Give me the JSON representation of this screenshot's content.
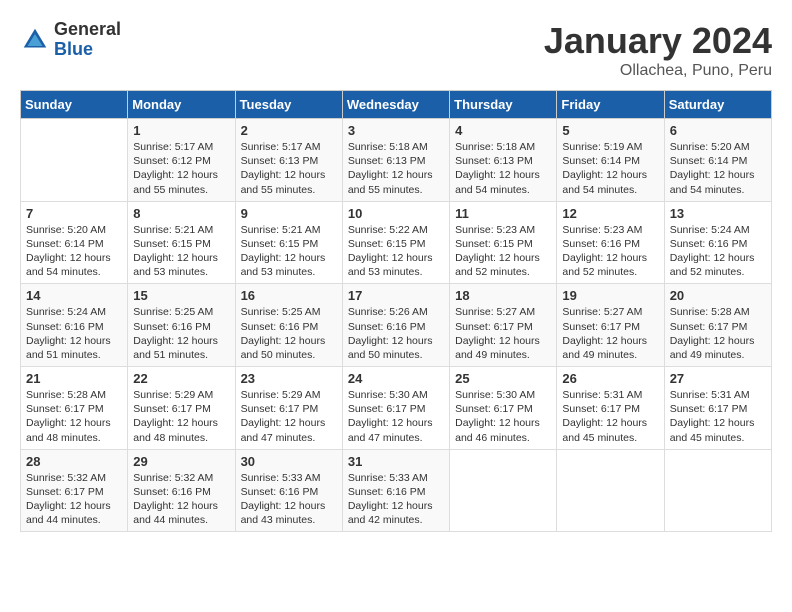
{
  "header": {
    "logo_general": "General",
    "logo_blue": "Blue",
    "month_title": "January 2024",
    "subtitle": "Ollachea, Puno, Peru"
  },
  "days_of_week": [
    "Sunday",
    "Monday",
    "Tuesday",
    "Wednesday",
    "Thursday",
    "Friday",
    "Saturday"
  ],
  "weeks": [
    [
      {
        "day": "",
        "info": ""
      },
      {
        "day": "1",
        "info": "Sunrise: 5:17 AM\nSunset: 6:12 PM\nDaylight: 12 hours\nand 55 minutes."
      },
      {
        "day": "2",
        "info": "Sunrise: 5:17 AM\nSunset: 6:13 PM\nDaylight: 12 hours\nand 55 minutes."
      },
      {
        "day": "3",
        "info": "Sunrise: 5:18 AM\nSunset: 6:13 PM\nDaylight: 12 hours\nand 55 minutes."
      },
      {
        "day": "4",
        "info": "Sunrise: 5:18 AM\nSunset: 6:13 PM\nDaylight: 12 hours\nand 54 minutes."
      },
      {
        "day": "5",
        "info": "Sunrise: 5:19 AM\nSunset: 6:14 PM\nDaylight: 12 hours\nand 54 minutes."
      },
      {
        "day": "6",
        "info": "Sunrise: 5:20 AM\nSunset: 6:14 PM\nDaylight: 12 hours\nand 54 minutes."
      }
    ],
    [
      {
        "day": "7",
        "info": "Sunrise: 5:20 AM\nSunset: 6:14 PM\nDaylight: 12 hours\nand 54 minutes."
      },
      {
        "day": "8",
        "info": "Sunrise: 5:21 AM\nSunset: 6:15 PM\nDaylight: 12 hours\nand 53 minutes."
      },
      {
        "day": "9",
        "info": "Sunrise: 5:21 AM\nSunset: 6:15 PM\nDaylight: 12 hours\nand 53 minutes."
      },
      {
        "day": "10",
        "info": "Sunrise: 5:22 AM\nSunset: 6:15 PM\nDaylight: 12 hours\nand 53 minutes."
      },
      {
        "day": "11",
        "info": "Sunrise: 5:23 AM\nSunset: 6:15 PM\nDaylight: 12 hours\nand 52 minutes."
      },
      {
        "day": "12",
        "info": "Sunrise: 5:23 AM\nSunset: 6:16 PM\nDaylight: 12 hours\nand 52 minutes."
      },
      {
        "day": "13",
        "info": "Sunrise: 5:24 AM\nSunset: 6:16 PM\nDaylight: 12 hours\nand 52 minutes."
      }
    ],
    [
      {
        "day": "14",
        "info": "Sunrise: 5:24 AM\nSunset: 6:16 PM\nDaylight: 12 hours\nand 51 minutes."
      },
      {
        "day": "15",
        "info": "Sunrise: 5:25 AM\nSunset: 6:16 PM\nDaylight: 12 hours\nand 51 minutes."
      },
      {
        "day": "16",
        "info": "Sunrise: 5:25 AM\nSunset: 6:16 PM\nDaylight: 12 hours\nand 50 minutes."
      },
      {
        "day": "17",
        "info": "Sunrise: 5:26 AM\nSunset: 6:16 PM\nDaylight: 12 hours\nand 50 minutes."
      },
      {
        "day": "18",
        "info": "Sunrise: 5:27 AM\nSunset: 6:17 PM\nDaylight: 12 hours\nand 49 minutes."
      },
      {
        "day": "19",
        "info": "Sunrise: 5:27 AM\nSunset: 6:17 PM\nDaylight: 12 hours\nand 49 minutes."
      },
      {
        "day": "20",
        "info": "Sunrise: 5:28 AM\nSunset: 6:17 PM\nDaylight: 12 hours\nand 49 minutes."
      }
    ],
    [
      {
        "day": "21",
        "info": "Sunrise: 5:28 AM\nSunset: 6:17 PM\nDaylight: 12 hours\nand 48 minutes."
      },
      {
        "day": "22",
        "info": "Sunrise: 5:29 AM\nSunset: 6:17 PM\nDaylight: 12 hours\nand 48 minutes."
      },
      {
        "day": "23",
        "info": "Sunrise: 5:29 AM\nSunset: 6:17 PM\nDaylight: 12 hours\nand 47 minutes."
      },
      {
        "day": "24",
        "info": "Sunrise: 5:30 AM\nSunset: 6:17 PM\nDaylight: 12 hours\nand 47 minutes."
      },
      {
        "day": "25",
        "info": "Sunrise: 5:30 AM\nSunset: 6:17 PM\nDaylight: 12 hours\nand 46 minutes."
      },
      {
        "day": "26",
        "info": "Sunrise: 5:31 AM\nSunset: 6:17 PM\nDaylight: 12 hours\nand 45 minutes."
      },
      {
        "day": "27",
        "info": "Sunrise: 5:31 AM\nSunset: 6:17 PM\nDaylight: 12 hours\nand 45 minutes."
      }
    ],
    [
      {
        "day": "28",
        "info": "Sunrise: 5:32 AM\nSunset: 6:17 PM\nDaylight: 12 hours\nand 44 minutes."
      },
      {
        "day": "29",
        "info": "Sunrise: 5:32 AM\nSunset: 6:16 PM\nDaylight: 12 hours\nand 44 minutes."
      },
      {
        "day": "30",
        "info": "Sunrise: 5:33 AM\nSunset: 6:16 PM\nDaylight: 12 hours\nand 43 minutes."
      },
      {
        "day": "31",
        "info": "Sunrise: 5:33 AM\nSunset: 6:16 PM\nDaylight: 12 hours\nand 42 minutes."
      },
      {
        "day": "",
        "info": ""
      },
      {
        "day": "",
        "info": ""
      },
      {
        "day": "",
        "info": ""
      }
    ]
  ]
}
